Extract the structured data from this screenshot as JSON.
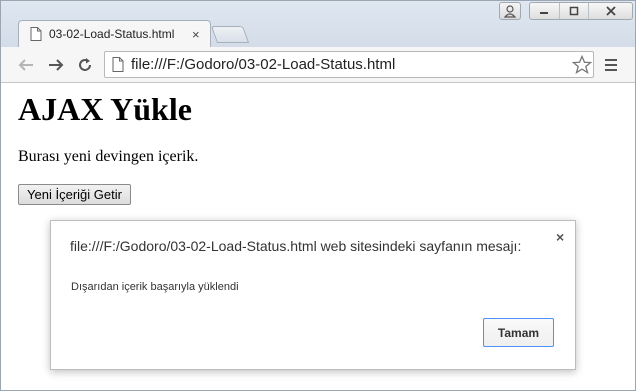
{
  "browser": {
    "tab": {
      "title": "03-02-Load-Status.html",
      "close_glyph": "×"
    },
    "address_bar": {
      "url": "file:///F:/Godoro/03-02-Load-Status.html"
    }
  },
  "page": {
    "heading": "AJAX Yükle",
    "paragraph": "Burası yeni devingen içerik.",
    "button_label": "Yeni İçeriği Getir"
  },
  "dialog": {
    "title": "file:///F:/Godoro/03-02-Load-Status.html web sitesindeki sayfanın mesajı:",
    "close_glyph": "×",
    "message": "Dışarıdan içerik başarıyla yüklendi",
    "ok_label": "Tamam"
  },
  "icons": {
    "back": "back-arrow-icon",
    "forward": "forward-arrow-icon",
    "reload": "reload-icon",
    "page": "page-icon",
    "star": "star-icon",
    "menu": "hamburger-menu-icon",
    "user": "user-icon",
    "minimize": "minimize-icon",
    "maximize": "maximize-icon",
    "close": "close-icon"
  },
  "colors": {
    "titlebar": "#d3dce8",
    "toolbar": "#f6f6f6",
    "focus_border": "#4d90fe"
  }
}
